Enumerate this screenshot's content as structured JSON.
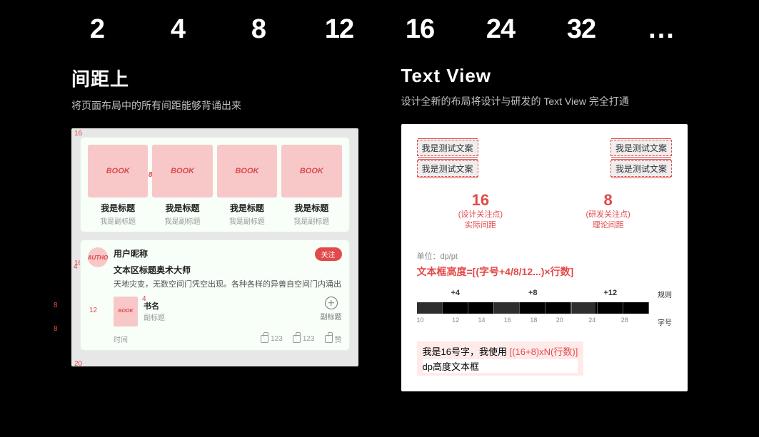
{
  "scale": [
    "2",
    "4",
    "8",
    "12",
    "16",
    "24",
    "32",
    "..."
  ],
  "left": {
    "heading": "间距上",
    "sub": "将页面布局中的所有间距能够背诵出来",
    "dims": {
      "top": "16",
      "cardGap": "8",
      "bottom": "20",
      "feedLeft": "16",
      "feedTop": "16",
      "artGap": "4",
      "bodyGap": "8",
      "miniGap": "12",
      "miniLabelGap": "4",
      "miniBottom": "8"
    },
    "books": [
      {
        "cover": "BOOK",
        "title": "我是标题",
        "sub": "我是副标题"
      },
      {
        "cover": "BOOK",
        "title": "我是标题",
        "sub": "我是副标题"
      },
      {
        "cover": "BOOK",
        "title": "我是标题",
        "sub": "我是副标题"
      },
      {
        "cover": "BOOK",
        "title": "我是标题",
        "sub": "我是副标题"
      }
    ],
    "feed": {
      "avatar": "AUTHO",
      "nick": "用户昵称",
      "follow": "关注",
      "article": "文本区标题奥术大师",
      "body": "天地灾变，无数空间门凭空出现。各种各样的异兽自空间门内涌出",
      "mini": {
        "cover": "BOOK",
        "title": "书名",
        "sub": "副标题"
      },
      "addSub": "副标题",
      "time": "时间",
      "likes": [
        "123",
        "123",
        "赞"
      ]
    }
  },
  "right": {
    "heading": "Text View",
    "sub": "设计全新的布局将设计与研发的 Text View 完全打通",
    "labels": [
      "我是测试文案",
      "我是测试文案",
      "我是测试文案",
      "我是测试文案"
    ],
    "focus": {
      "a": {
        "big": "16",
        "l1": "(设计关注点)",
        "l2": "实际间距"
      },
      "b": {
        "big": "8",
        "l1": "(研发关注点)",
        "l2": "理论间距"
      }
    },
    "unit": "单位：dp/pt",
    "formula": "文本框高度=[(字号+4/8/12...)×行数]",
    "ruler": {
      "heads": [
        "+4",
        "+8",
        "+12"
      ],
      "ruleTag": "规则",
      "ticks": [
        "10",
        "12",
        "14",
        "16",
        "18",
        "20",
        "24",
        "28"
      ],
      "sizeTag": "字号"
    },
    "example": {
      "pre": "我是16号字，我使用",
      "red": "[(16+8)xN(行数)]",
      "line2": "dp高度文本框"
    }
  }
}
